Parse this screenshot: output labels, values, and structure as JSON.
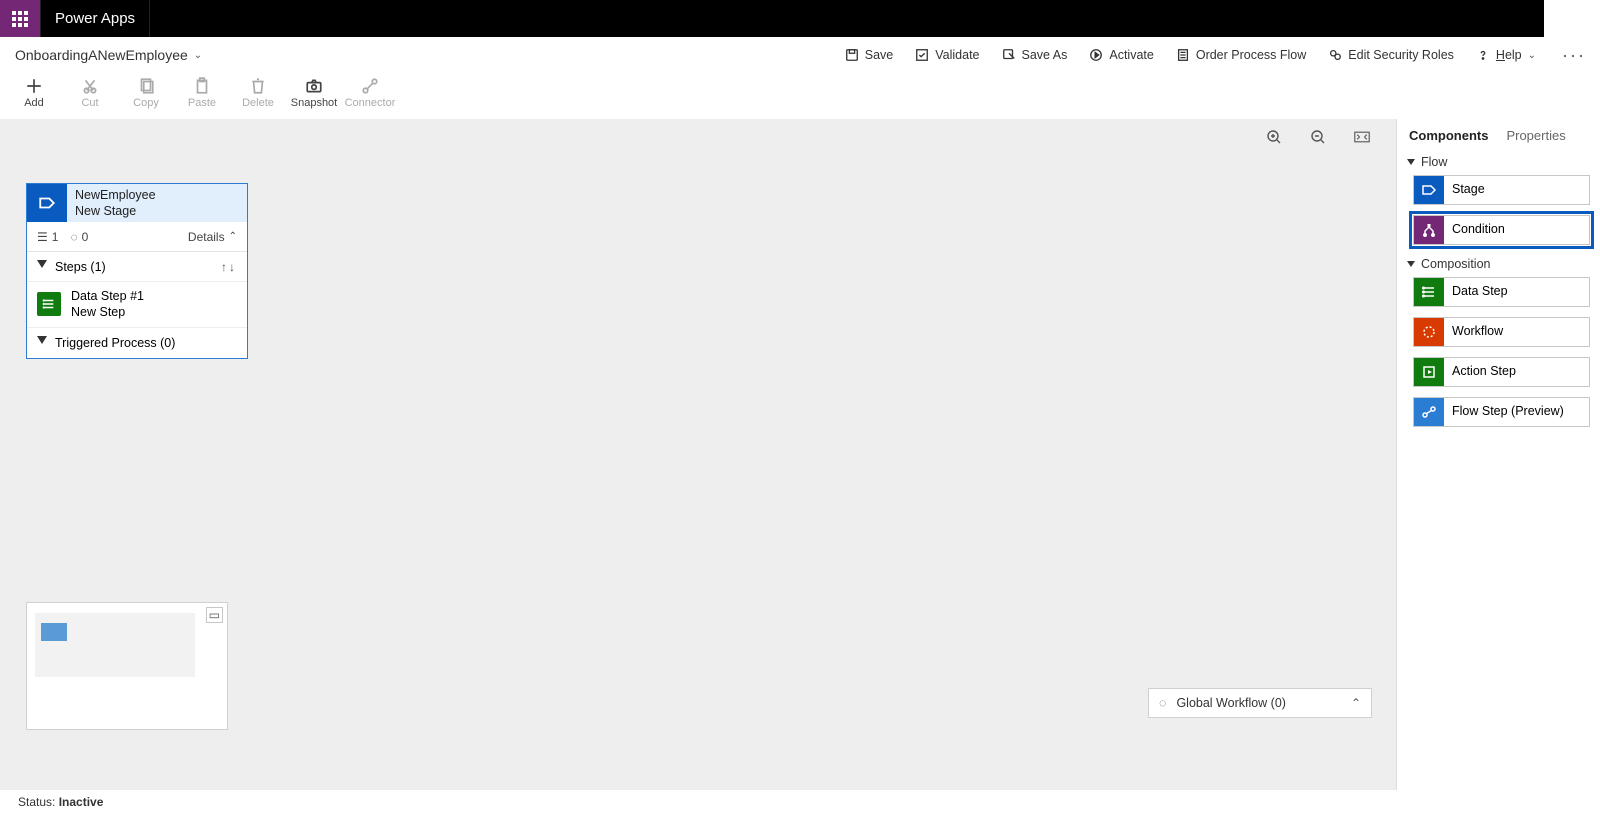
{
  "brand": "Power Apps",
  "flow": {
    "name": "OnboardingANewEmployee"
  },
  "actions": {
    "save": "Save",
    "validate": "Validate",
    "save_as": "Save As",
    "activate": "Activate",
    "order": "Order Process Flow",
    "security": "Edit Security Roles",
    "help": "Help"
  },
  "tools": {
    "add": "Add",
    "cut": "Cut",
    "copy": "Copy",
    "paste": "Paste",
    "delete": "Delete",
    "snapshot": "Snapshot",
    "connector": "Connector"
  },
  "stage": {
    "title": "NewEmployee",
    "subtitle": "New Stage",
    "steps_count_glyph": "1",
    "workflow_count_glyph": "0",
    "details_label": "Details",
    "steps_label": "Steps (1)",
    "step": {
      "title": "Data Step #1",
      "subtitle": "New Step"
    },
    "triggered_label": "Triggered Process (0)"
  },
  "globalWorkflow": {
    "label": "Global Workflow (0)"
  },
  "panel": {
    "tab_components": "Components",
    "tab_properties": "Properties",
    "section_flow": "Flow",
    "section_composition": "Composition",
    "items": {
      "stage": "Stage",
      "condition": "Condition",
      "data_step": "Data Step",
      "workflow": "Workflow",
      "action_step": "Action Step",
      "flow_step": "Flow Step (Preview)"
    }
  },
  "status": {
    "label": "Status:",
    "value": "Inactive"
  }
}
